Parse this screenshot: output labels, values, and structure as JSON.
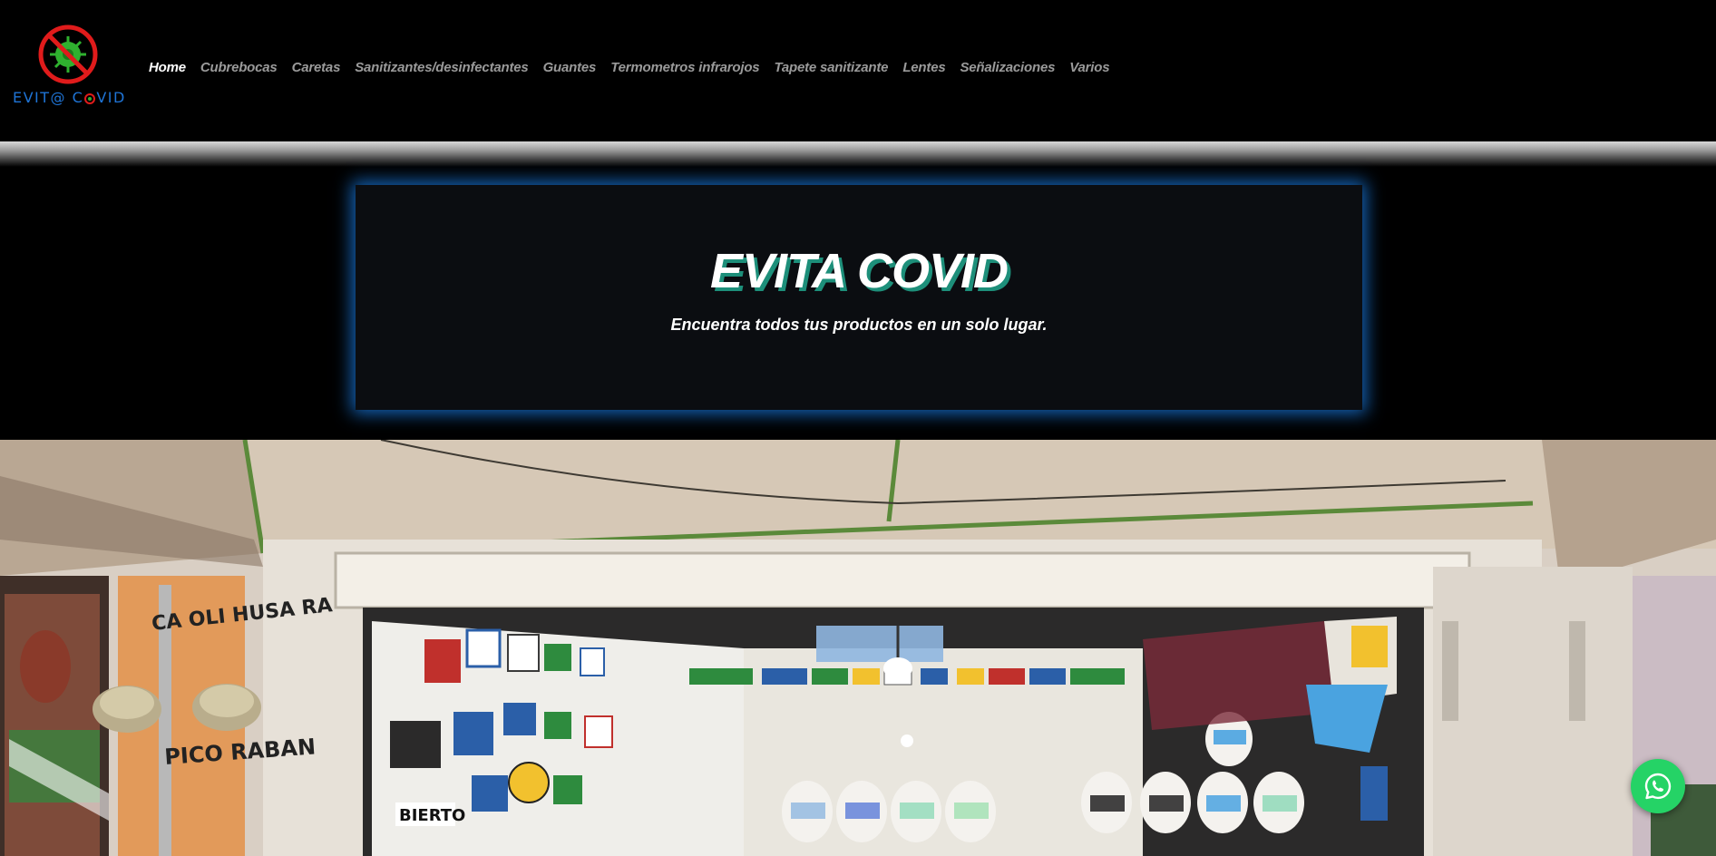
{
  "header": {
    "logo": {
      "mark_icon": "no-virus-icon",
      "text_part1": "EVIT@ C",
      "text_part2": "VID",
      "brand_blue": "#1f74d6",
      "ban_red": "#e01b1b",
      "virus_green": "#2fb12f"
    },
    "nav": [
      {
        "label": "Home",
        "active": true
      },
      {
        "label": "Cubrebocas",
        "active": false
      },
      {
        "label": "Caretas",
        "active": false
      },
      {
        "label": "Sanitizantes/desinfectantes",
        "active": false
      },
      {
        "label": "Guantes",
        "active": false
      },
      {
        "label": "Termometros infrarojos",
        "active": false
      },
      {
        "label": "Tapete sanitizante",
        "active": false
      },
      {
        "label": "Lentes",
        "active": false
      },
      {
        "label": "Señalizaciones",
        "active": false
      },
      {
        "label": "Varios",
        "active": false
      }
    ]
  },
  "hero": {
    "title": "EVITA COVID",
    "subtitle": "Encuentra todos tus productos en un solo lugar.",
    "glow_color": "#1978dc",
    "title_shadow_color": "#1d8f7a"
  },
  "storefront_photo": {
    "signs": {
      "left_poster_1": "CA OLI HUSA RA",
      "left_poster_2": "PICO RABAN",
      "shop_sign": "BIERTO"
    }
  },
  "whatsapp": {
    "icon": "whatsapp-icon",
    "color": "#25d366"
  }
}
